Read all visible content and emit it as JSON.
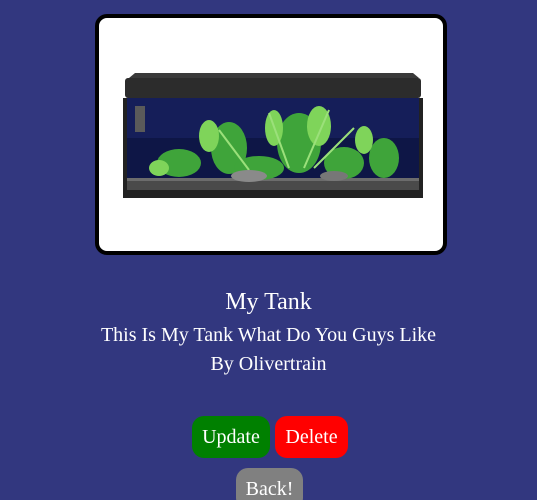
{
  "tank": {
    "title": "My Tank",
    "description": "This Is My Tank What Do You Guys Like",
    "author": "By Olivertrain"
  },
  "actions": {
    "update_label": "Update",
    "delete_label": "Delete",
    "back_label": "Back!"
  },
  "colors": {
    "background": "#32377f",
    "update": "#008000",
    "delete": "#ff0000",
    "back": "#808080"
  }
}
